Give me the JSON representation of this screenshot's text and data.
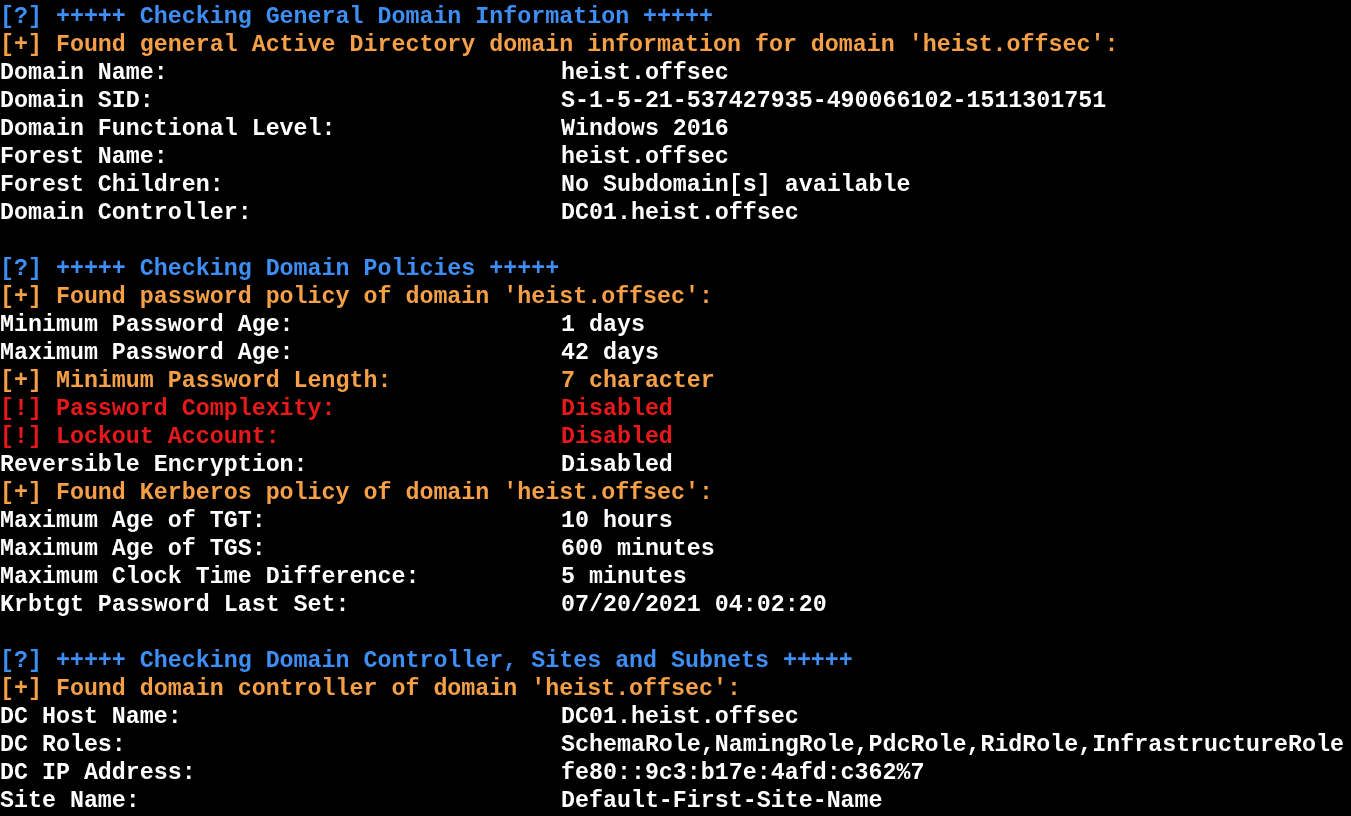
{
  "sections": [
    {
      "header": "[?] +++++ Checking General Domain Information +++++",
      "lines": [
        {
          "kind": "found",
          "text": "[+] Found general Active Directory domain information for domain 'heist.offsec':"
        },
        {
          "kind": "field",
          "label": "Domain Name:",
          "value": "heist.offsec"
        },
        {
          "kind": "field",
          "label": "Domain SID:",
          "value": "S-1-5-21-537427935-490066102-1511301751"
        },
        {
          "kind": "field",
          "label": "Domain Functional Level:",
          "value": "Windows 2016"
        },
        {
          "kind": "field",
          "label": "Forest Name:",
          "value": "heist.offsec"
        },
        {
          "kind": "field",
          "label": "Forest Children:",
          "value": "No Subdomain[s] available"
        },
        {
          "kind": "field",
          "label": "Domain Controller:",
          "value": "DC01.heist.offsec"
        }
      ]
    },
    {
      "header": "[?] +++++ Checking Domain Policies +++++",
      "lines": [
        {
          "kind": "found",
          "text": "[+] Found password policy of domain 'heist.offsec':"
        },
        {
          "kind": "field",
          "label": "Minimum Password Age:",
          "value": "1 days"
        },
        {
          "kind": "field",
          "label": "Maximum Password Age:",
          "value": "42 days"
        },
        {
          "kind": "good",
          "label": "[+] Minimum Password Length:",
          "value": "7 character"
        },
        {
          "kind": "alert",
          "label": "[!] Password Complexity:",
          "value": "Disabled"
        },
        {
          "kind": "alert",
          "label": "[!] Lockout Account:",
          "value": "Disabled"
        },
        {
          "kind": "field",
          "label": "Reversible Encryption:",
          "value": "Disabled"
        },
        {
          "kind": "found",
          "text": "[+] Found Kerberos policy of domain 'heist.offsec':"
        },
        {
          "kind": "field",
          "label": "Maximum Age of TGT:",
          "value": "10 hours"
        },
        {
          "kind": "field",
          "label": "Maximum Age of TGS:",
          "value": "600 minutes"
        },
        {
          "kind": "field",
          "label": "Maximum Clock Time Difference:",
          "value": "5 minutes"
        },
        {
          "kind": "field",
          "label": "Krbtgt Password Last Set:",
          "value": "07/20/2021 04:02:20"
        }
      ]
    },
    {
      "header": "[?] +++++ Checking Domain Controller, Sites and Subnets +++++",
      "lines": [
        {
          "kind": "found",
          "text": "[+] Found domain controller of domain 'heist.offsec':"
        },
        {
          "kind": "field",
          "label": "DC Host Name:",
          "value": "DC01.heist.offsec"
        },
        {
          "kind": "field",
          "label": "DC Roles:",
          "value": "SchemaRole,NamingRole,PdcRole,RidRole,InfrastructureRole"
        },
        {
          "kind": "field",
          "label": "DC IP Address:",
          "value": "fe80::9c3:b17e:4afd:c362%7"
        },
        {
          "kind": "field",
          "label": "Site Name:",
          "value": "Default-First-Site-Name"
        }
      ]
    }
  ]
}
